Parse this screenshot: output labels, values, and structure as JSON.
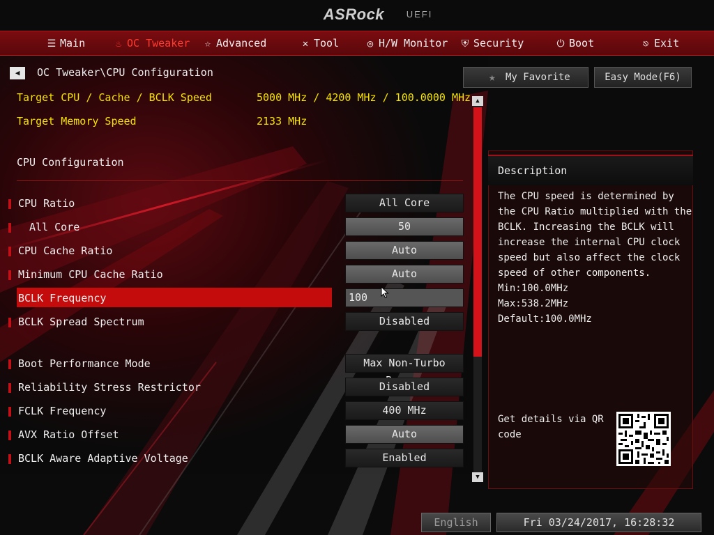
{
  "brand": {
    "logo": "ASRock",
    "uefi": "UEFI"
  },
  "menu": [
    {
      "label": "Main",
      "icon": "list-icon",
      "active": false
    },
    {
      "label": "OC Tweaker",
      "icon": "flame-icon",
      "active": true
    },
    {
      "label": "Advanced",
      "icon": "star-icon",
      "active": false
    },
    {
      "label": "Tool",
      "icon": "wrench-icon",
      "active": false
    },
    {
      "label": "H/W Monitor",
      "icon": "monitor-icon",
      "active": false
    },
    {
      "label": "Security",
      "icon": "shield-icon",
      "active": false
    },
    {
      "label": "Boot",
      "icon": "power-icon",
      "active": false
    },
    {
      "label": "Exit",
      "icon": "exit-icon",
      "active": false
    }
  ],
  "breadcrumb": "OC Tweaker\\CPU Configuration",
  "targets": [
    {
      "label": "Target CPU / Cache / BCLK Speed",
      "value": "5000 MHz / 4200 MHz / 100.0000 MHz"
    },
    {
      "label": "Target Memory Speed",
      "value": "2133 MHz"
    }
  ],
  "section_title": "CPU Configuration",
  "settings": [
    {
      "label": "CPU Ratio",
      "value": "All Core",
      "style": "dark",
      "indent": false
    },
    {
      "label": "All Core",
      "value": "50",
      "style": "light",
      "indent": true
    },
    {
      "label": "CPU Cache Ratio",
      "value": "Auto",
      "style": "light",
      "indent": false
    },
    {
      "label": "Minimum CPU Cache Ratio",
      "value": "Auto",
      "style": "light",
      "indent": false
    },
    {
      "label": "BCLK Frequency",
      "value": "100",
      "style": "input",
      "indent": false,
      "selected": true
    },
    {
      "label": "BCLK Spread Spectrum",
      "value": "Disabled",
      "style": "dark",
      "indent": false
    },
    {
      "label": "Boot Performance Mode",
      "value": "Max Non-Turbo Per...",
      "style": "dark",
      "indent": false
    },
    {
      "label": "Reliability Stress Restrictor",
      "value": "Disabled",
      "style": "dark",
      "indent": false
    },
    {
      "label": "FCLK Frequency",
      "value": "400 MHz",
      "style": "dark",
      "indent": false
    },
    {
      "label": "AVX Ratio Offset",
      "value": "Auto",
      "style": "light",
      "indent": false
    },
    {
      "label": "BCLK Aware Adaptive Voltage",
      "value": "Enabled",
      "style": "dark",
      "indent": false
    }
  ],
  "right_panel": {
    "favorite_label": "My Favorite",
    "easy_mode_label": "Easy Mode(F6)",
    "description_title": "Description",
    "description_lines": [
      "The CPU speed is determined by",
      "the CPU Ratio multiplied with the",
      "BCLK. Increasing the BCLK will",
      "increase the internal CPU clock",
      "speed but also affect the clock",
      "speed of other components.",
      "Min:100.0MHz",
      "Max:538.2MHz",
      "Default:100.0MHz"
    ],
    "qr_lines": [
      "Get details via QR",
      "code"
    ]
  },
  "footer": {
    "language": "English",
    "datetime": "Fri 03/24/2017, 16:28:32"
  },
  "colors": {
    "accent": "#c50c0c",
    "target_text": "#f5e200",
    "menubar": "#6a0a0e"
  }
}
